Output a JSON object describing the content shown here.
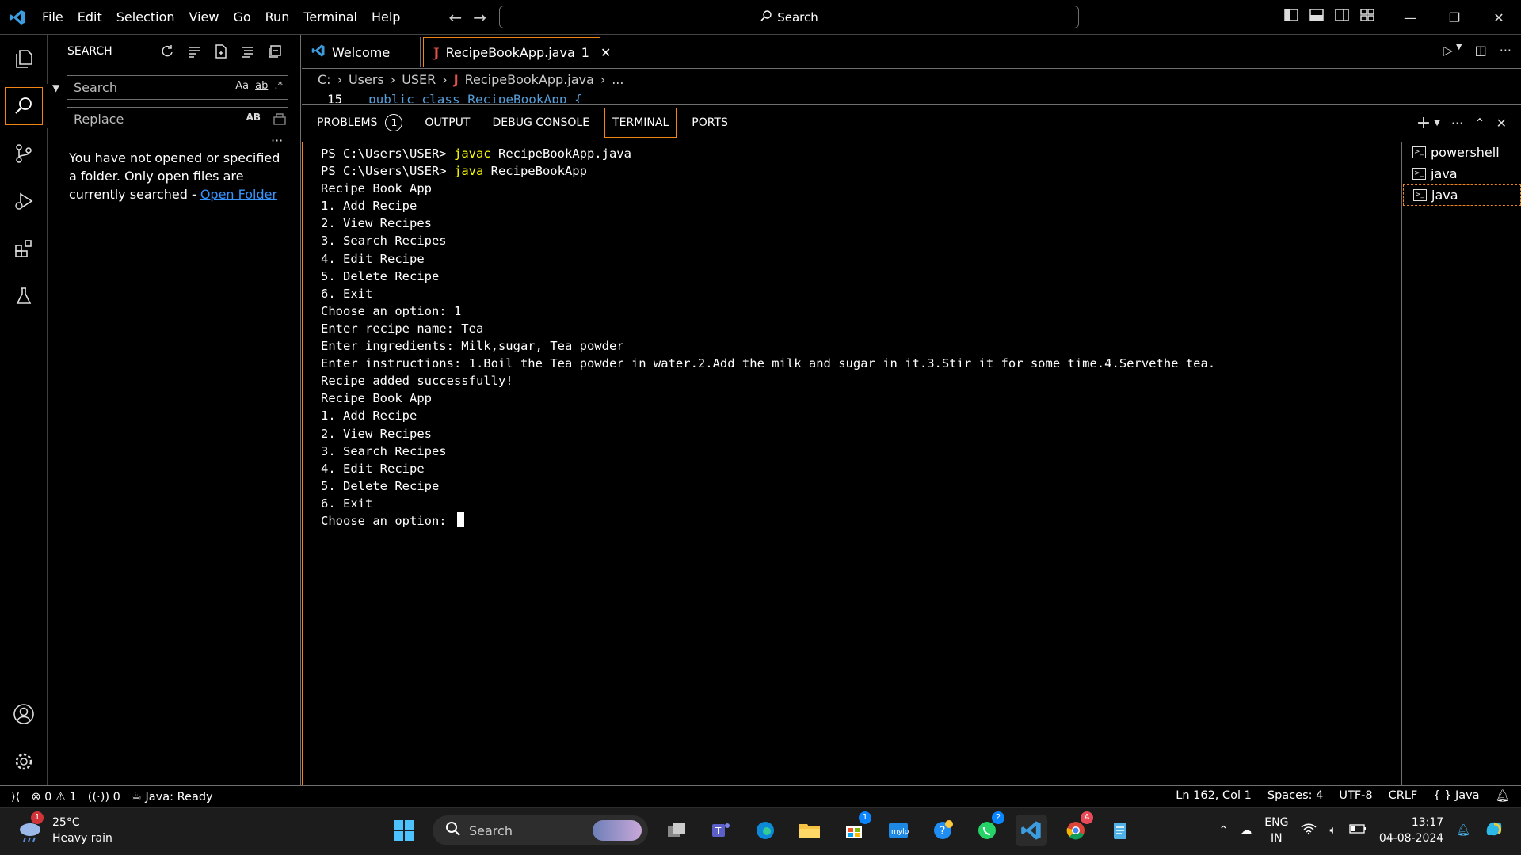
{
  "app": {
    "menu": [
      "File",
      "Edit",
      "Selection",
      "View",
      "Go",
      "Run",
      "Terminal",
      "Help"
    ],
    "command_center": "Search"
  },
  "sidebar": {
    "title": "SEARCH",
    "search_placeholder": "Search",
    "replace_placeholder": "Replace",
    "match_case": "Aa",
    "whole_word": "ab",
    "regex": ".*",
    "preserve_case": "AB",
    "message": "You have not opened or specified a folder. Only open files are currently searched - ",
    "open_folder_link": "Open Folder"
  },
  "tabs": [
    {
      "label": "Welcome"
    },
    {
      "label": "RecipeBookApp.java",
      "badge": "1"
    }
  ],
  "breadcrumb": [
    "C:",
    "Users",
    "USER",
    "RecipeBookApp.java",
    "..."
  ],
  "editor": {
    "line_number": "15",
    "code": "public class RecipeBookApp {"
  },
  "panel": {
    "tabs": [
      "PROBLEMS",
      "OUTPUT",
      "DEBUG CONSOLE",
      "TERMINAL",
      "PORTS"
    ],
    "problems_count": "1",
    "terminal_lines": [
      {
        "prompt": "PS C:\\Users\\USER> ",
        "cmd": "javac",
        "rest": " RecipeBookApp.java"
      },
      {
        "prompt": "PS C:\\Users\\USER> ",
        "cmd": "java",
        "rest": " RecipeBookApp"
      },
      {
        "text": "Recipe Book App"
      },
      {
        "text": "1. Add Recipe"
      },
      {
        "text": "2. View Recipes"
      },
      {
        "text": "3. Search Recipes"
      },
      {
        "text": "4. Edit Recipe"
      },
      {
        "text": "5. Delete Recipe"
      },
      {
        "text": "6. Exit"
      },
      {
        "text": "Choose an option: 1"
      },
      {
        "text": "Enter recipe name: Tea"
      },
      {
        "text": "Enter ingredients: Milk,sugar, Tea powder"
      },
      {
        "text": "Enter instructions: 1.Boil the Tea powder in water.2.Add the milk and sugar in it.3.Stir it for some time.4.Servethe tea."
      },
      {
        "text": "Recipe added successfully!"
      },
      {
        "text": "Recipe Book App"
      },
      {
        "text": "1. Add Recipe"
      },
      {
        "text": "2. View Recipes"
      },
      {
        "text": "3. Search Recipes"
      },
      {
        "text": "4. Edit Recipe"
      },
      {
        "text": "5. Delete Recipe"
      },
      {
        "text": "6. Exit"
      },
      {
        "text": "Choose an option: ",
        "cursor": true
      }
    ],
    "terminal_instances": [
      "powershell",
      "java",
      "java"
    ]
  },
  "statusbar": {
    "errors": "0",
    "warnings": "1",
    "ports": "0",
    "java_status": "Java: Ready",
    "position": "Ln 162, Col 1",
    "spaces": "Spaces: 4",
    "encoding": "UTF-8",
    "eol": "CRLF",
    "language": "Java"
  },
  "taskbar": {
    "temperature": "25°C",
    "weather": "Heavy rain",
    "weather_badge": "1",
    "search_placeholder": "Search",
    "store_badge": "1",
    "whatsapp_badge": "2",
    "chrome_badge": "A",
    "lang_top": "ENG",
    "lang_bottom": "IN",
    "time": "13:17",
    "date": "04-08-2024"
  },
  "colors": {
    "focus_border": "#f38518",
    "link": "#3794ff",
    "terminal_command": "#ffff00",
    "keyword": "#569cd6"
  }
}
